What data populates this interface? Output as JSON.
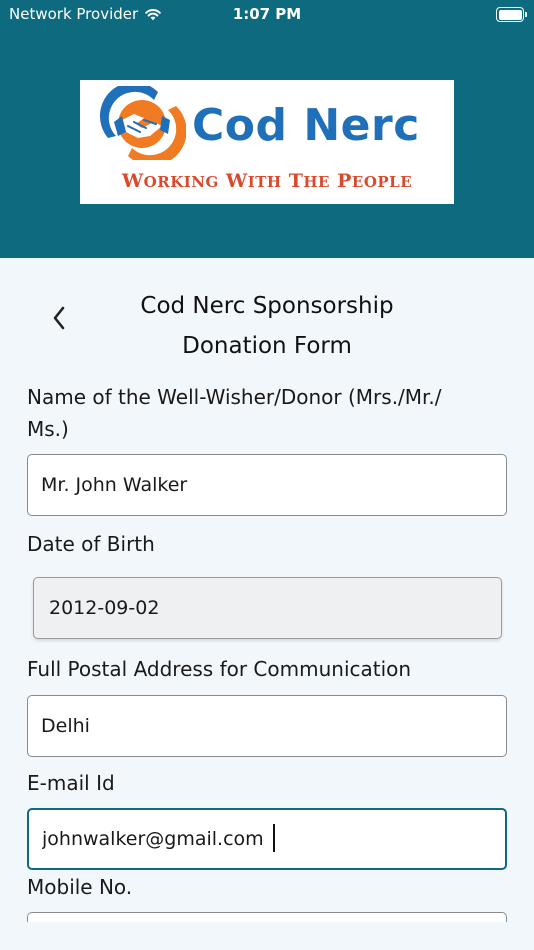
{
  "status_bar": {
    "carrier": "Network Provider",
    "time": "1:07 PM"
  },
  "brand": {
    "name": "Cod Nerc",
    "tagline_words": [
      {
        "cap": "W",
        "rest": "ORKING"
      },
      {
        "cap": "W",
        "rest": "ITH"
      },
      {
        "cap": "T",
        "rest": "HE"
      },
      {
        "cap": "P",
        "rest": "EOPLE"
      }
    ],
    "colors": {
      "header": "#0e6a7e",
      "name": "#1f6fb9",
      "tagline": "#d94a2c",
      "emblem_orange": "#f07b22",
      "emblem_blue": "#1f6fb9"
    }
  },
  "form": {
    "title_line1": "Cod Nerc Sponsorship",
    "title_line2": "Donation Form",
    "name_label_line1": "Name of the Well-Wisher/Donor (Mrs./Mr./",
    "name_label_line2": "Ms.)",
    "name_value": "Mr. John Walker",
    "dob_label": "Date of Birth",
    "dob_value": "2012-09-02",
    "address_label": "Full Postal Address for Communication",
    "address_value": "Delhi",
    "email_label": "E-mail Id",
    "email_value": "johnwalker@gmail.com",
    "mobile_label": "Mobile No."
  },
  "icons": {
    "back": "chevron-left-icon",
    "wifi": "wifi-icon",
    "battery": "battery-icon",
    "logo": "handshake-icon"
  }
}
